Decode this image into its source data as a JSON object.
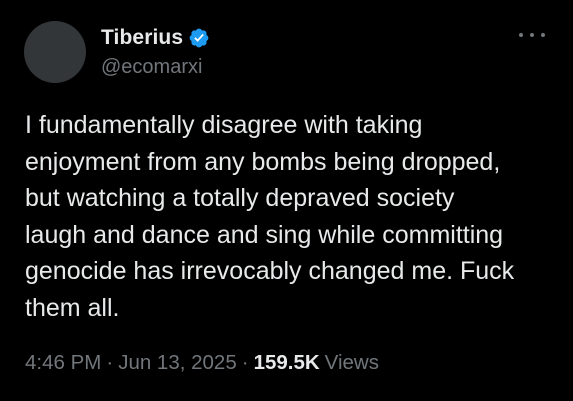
{
  "author": {
    "display_name": "Tiberius",
    "handle": "@ecomarxi",
    "verified_icon": "verified-badge-icon"
  },
  "colors": {
    "background": "#000000",
    "primary_text": "#e7e9ea",
    "secondary_text": "#71767b",
    "verified_blue": "#1d9bf0",
    "avatar_placeholder": "#333639"
  },
  "menu_icon": "more-horizontal-icon",
  "tweet": {
    "lines": [
      "I fundamentally disagree with taking",
      "enjoyment from any bombs being dropped,",
      "but watching a totally depraved society",
      "laugh and dance and sing while committing",
      "genocide has irrevocably changed me. Fuck",
      "them all."
    ]
  },
  "meta": {
    "time": "4:46 PM",
    "separator": "·",
    "date": "Jun 13, 2025",
    "views_count": "159.5K",
    "views_label": "Views"
  }
}
